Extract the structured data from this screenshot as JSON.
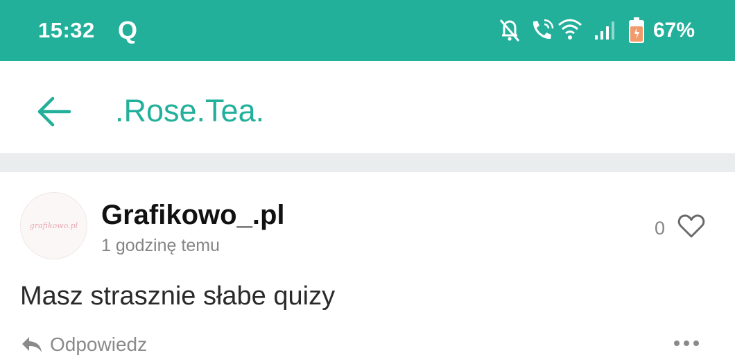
{
  "status_bar": {
    "time": "15:32",
    "app_letter": "Q",
    "battery": "67%",
    "icons": [
      "bell-off-icon",
      "wifi-call-icon",
      "wifi-icon",
      "signal-icon",
      "battery-charging-icon"
    ]
  },
  "header": {
    "title": ".Rose.Tea."
  },
  "comment": {
    "author": "Grafikowo_.pl",
    "avatar_text": "grafikowo.pl",
    "time": "1 godzinę temu",
    "likes": "0",
    "text": "Masz strasznie słabe quizy",
    "reply_label": "Odpowiedz"
  },
  "colors": {
    "accent": "#22b09b",
    "divider": "#e9eded",
    "muted_text": "#858585",
    "battery_fill": "#f39a6b"
  }
}
